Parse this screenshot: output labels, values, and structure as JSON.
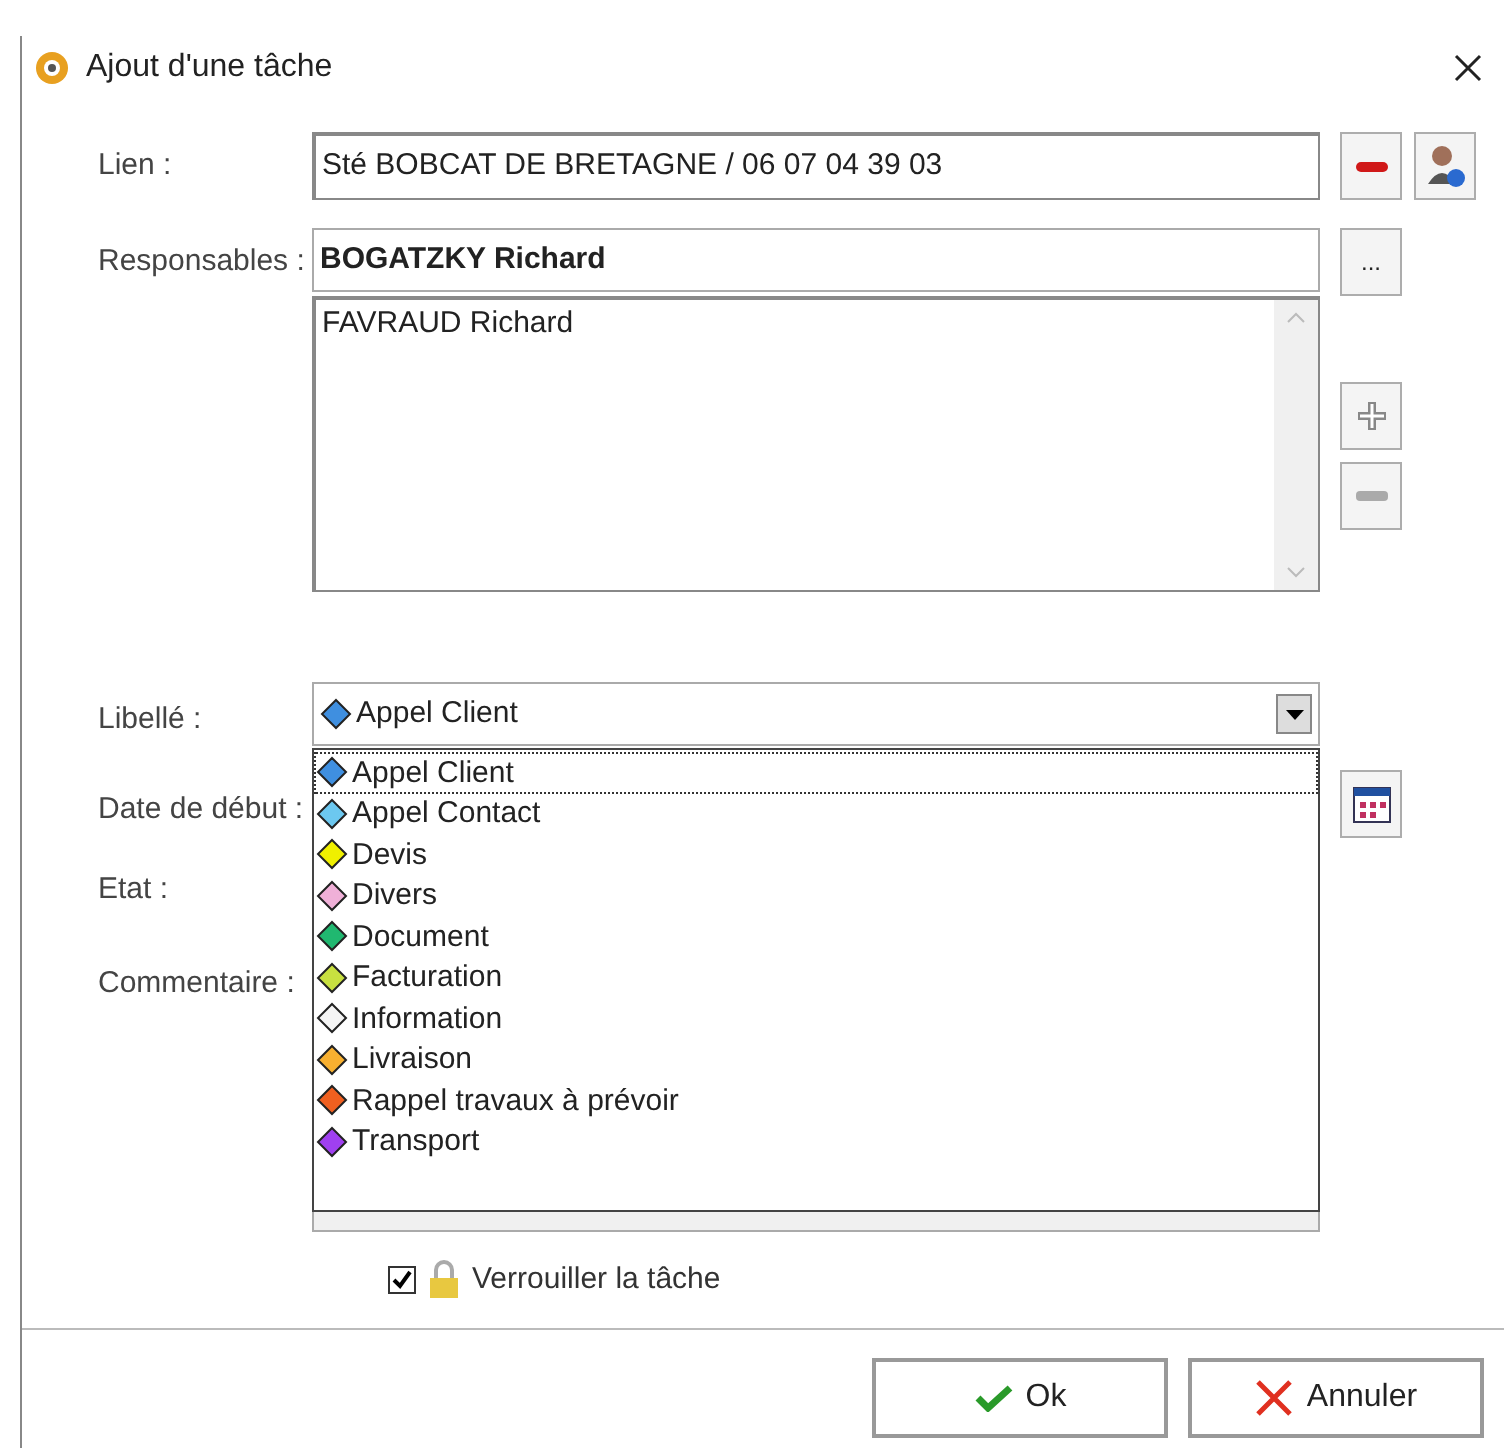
{
  "window": {
    "title": "Ajout d'une tâche"
  },
  "lien": {
    "label": "Lien :",
    "value": "Sté BOBCAT DE BRETAGNE / 06 07 04 39 03"
  },
  "responsables": {
    "label": "Responsables :",
    "value": "BOGATZKY Richard",
    "more_button": "...",
    "list": [
      "FAVRAUD Richard"
    ]
  },
  "libelle": {
    "label": "Libellé :",
    "value": "Appel Client",
    "color": "#3f8fe0",
    "expanded": true
  },
  "labels": [
    "Date de début :",
    "Etat :",
    "Commentaire :"
  ],
  "options": [
    {
      "label": "Appel Client",
      "color": "#3f8fe0",
      "selected": true
    },
    {
      "label": "Appel Contact",
      "color": "#6cc8f0",
      "selected": false
    },
    {
      "label": "Devis",
      "color": "#f0f000",
      "selected": false
    },
    {
      "label": "Divers",
      "color": "#f0b0d8",
      "selected": false
    },
    {
      "label": "Document",
      "color": "#20b870",
      "selected": false
    },
    {
      "label": "Facturation",
      "color": "#c8e040",
      "selected": false
    },
    {
      "label": "Information",
      "color": "#f4f4f4",
      "selected": false
    },
    {
      "label": "Livraison",
      "color": "#f8b030",
      "selected": false
    },
    {
      "label": "Rappel travaux à prévoir",
      "color": "#f06020",
      "selected": false
    },
    {
      "label": "Transport",
      "color": "#a040f0",
      "selected": false
    }
  ],
  "lock": {
    "label": "Verrouiller la tâche",
    "checked": true
  },
  "buttons": [
    {
      "kind": "ok",
      "label": "Ok"
    },
    {
      "kind": "cancel",
      "label": "Annuler"
    }
  ]
}
